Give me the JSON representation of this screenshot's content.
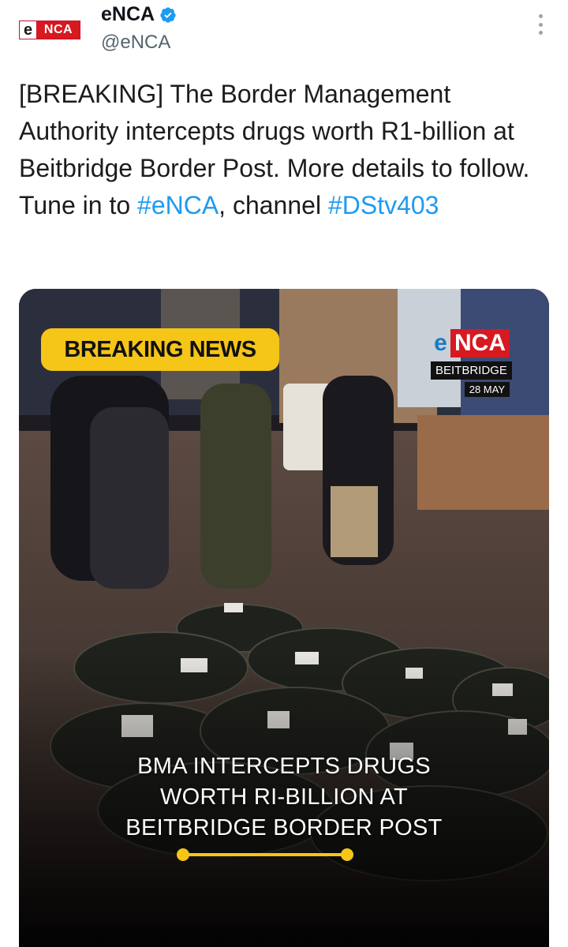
{
  "account": {
    "logo_e": "e",
    "logo_text": "NCA",
    "display_name": "eNCA",
    "handle": "@eNCA",
    "verified": true
  },
  "tweet": {
    "text_before": "[BREAKING] The Border Management Authority intercepts drugs worth R1-billion at Beitbridge Border Post. More details to follow. Tune in to ",
    "hashtag_1": "#eNCA",
    "text_middle": ", channel ",
    "hashtag_2": "#DStv403"
  },
  "media": {
    "badge": "BREAKING NEWS",
    "station_logo_e": "e",
    "station_logo_text": "NCA",
    "location": "BEITBRIDGE",
    "date": "28 MAY",
    "caption_lines": [
      "BMA INTERCEPTS DRUGS",
      "WORTH RI-BILLION AT",
      "BEITBRIDGE BORDER POST"
    ]
  },
  "colors": {
    "hashtag": "#1d9bf0",
    "badge_yellow": "#f5c518",
    "brand_red": "#d71920"
  },
  "icons": [
    "verified-badge-icon",
    "more-options-icon"
  ]
}
